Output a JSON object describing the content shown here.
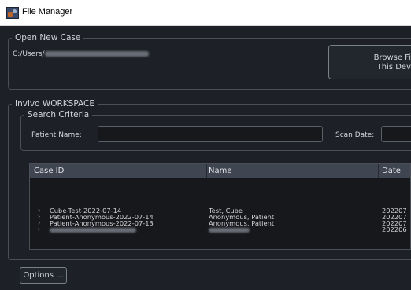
{
  "window": {
    "title": "File Manager"
  },
  "open_new_case": {
    "legend": "Open New Case",
    "path_prefix": "C:/Users/",
    "browse_button": {
      "line1": "Browse Fi",
      "line2": "This Dev"
    }
  },
  "workspace": {
    "legend": "Invivo WORKSPACE",
    "search_criteria": {
      "legend": "Search Criteria",
      "patient_name_label": "Patient Name:",
      "patient_name_value": "",
      "scan_date_label": "Scan Date:",
      "scan_date_value": ""
    },
    "table": {
      "columns": [
        "Case ID",
        "Name",
        "Date"
      ],
      "rows": [
        {
          "case_id": "Cube-Test-2022-07-14",
          "name": "Test, Cube",
          "date": "202207"
        },
        {
          "case_id": "Patient-Anonymous-2022-07-14",
          "name": "Anonymous, Patient",
          "date": "202207"
        },
        {
          "case_id": "Patient-Anonymous-2022-07-13",
          "name": "Anonymous, Patient",
          "date": "202207"
        },
        {
          "case_id": "",
          "name": "",
          "date": "202206"
        }
      ]
    }
  },
  "options_button": "Options ...",
  "colors": {
    "background": "#1d2026",
    "header": "#3f4651",
    "border": "#4b5058",
    "text": "#d4d6da"
  },
  "icons": {
    "app": "file-manager-icon",
    "expand": "chevron-right-icon"
  }
}
